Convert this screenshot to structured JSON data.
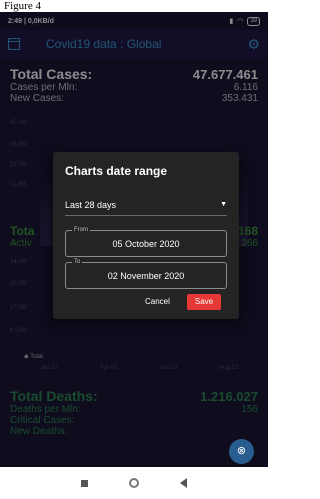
{
  "caption": "Figure 4",
  "status_bar": {
    "time": "2:49 | 0,0KB/d",
    "battery": "39"
  },
  "app_bar": {
    "title": "Covid19 data : Global"
  },
  "summary": {
    "total_cases_label": "Total Cases:",
    "total_cases_value": "47.677.461",
    "cases_per_mln_label": "Cases per Mln:",
    "cases_per_mln_value": "6.116",
    "new_cases_label": "New Cases:",
    "new_cases_value": "353.431"
  },
  "chart1": {
    "y_ticks": [
      "47.3M",
      "35.5M",
      "23.7M",
      "11.8M"
    ]
  },
  "active": {
    "label1": "Tota",
    "label2": "Activ",
    "value1": "168",
    "value2": "266"
  },
  "chart2": {
    "y_ticks": [
      "34.0M",
      "25.5M",
      "17.0M",
      "8.51M"
    ],
    "legend": "Total",
    "x_ticks": [
      "Jan 22",
      "Apr 02",
      "Jun 13",
      "Aug 23"
    ]
  },
  "deaths": {
    "total_deaths_label": "Total Deaths:",
    "total_deaths_value": "1.216.027",
    "deaths_per_mln_label": "Deaths per Mln:",
    "deaths_per_mln_value": "156",
    "critical_label": "Critical Cases:",
    "new_deaths_label": "New Deaths:"
  },
  "dialog": {
    "title": "Charts date range",
    "range_selected": "Last 28 days",
    "from_label": "From",
    "from_value": "05 October 2020",
    "to_label": "To",
    "to_value": "02 November 2020",
    "cancel_label": "Cancel",
    "save_label": "Save"
  },
  "colors": {
    "accent": "#3f9ad6",
    "save": "#e53935",
    "background": "#1b1636"
  },
  "icons": [
    "calendar-icon",
    "gear-icon",
    "dropdown-caret-icon",
    "fab-icon",
    "nav-recent-icon",
    "nav-home-icon",
    "nav-back-icon"
  ]
}
